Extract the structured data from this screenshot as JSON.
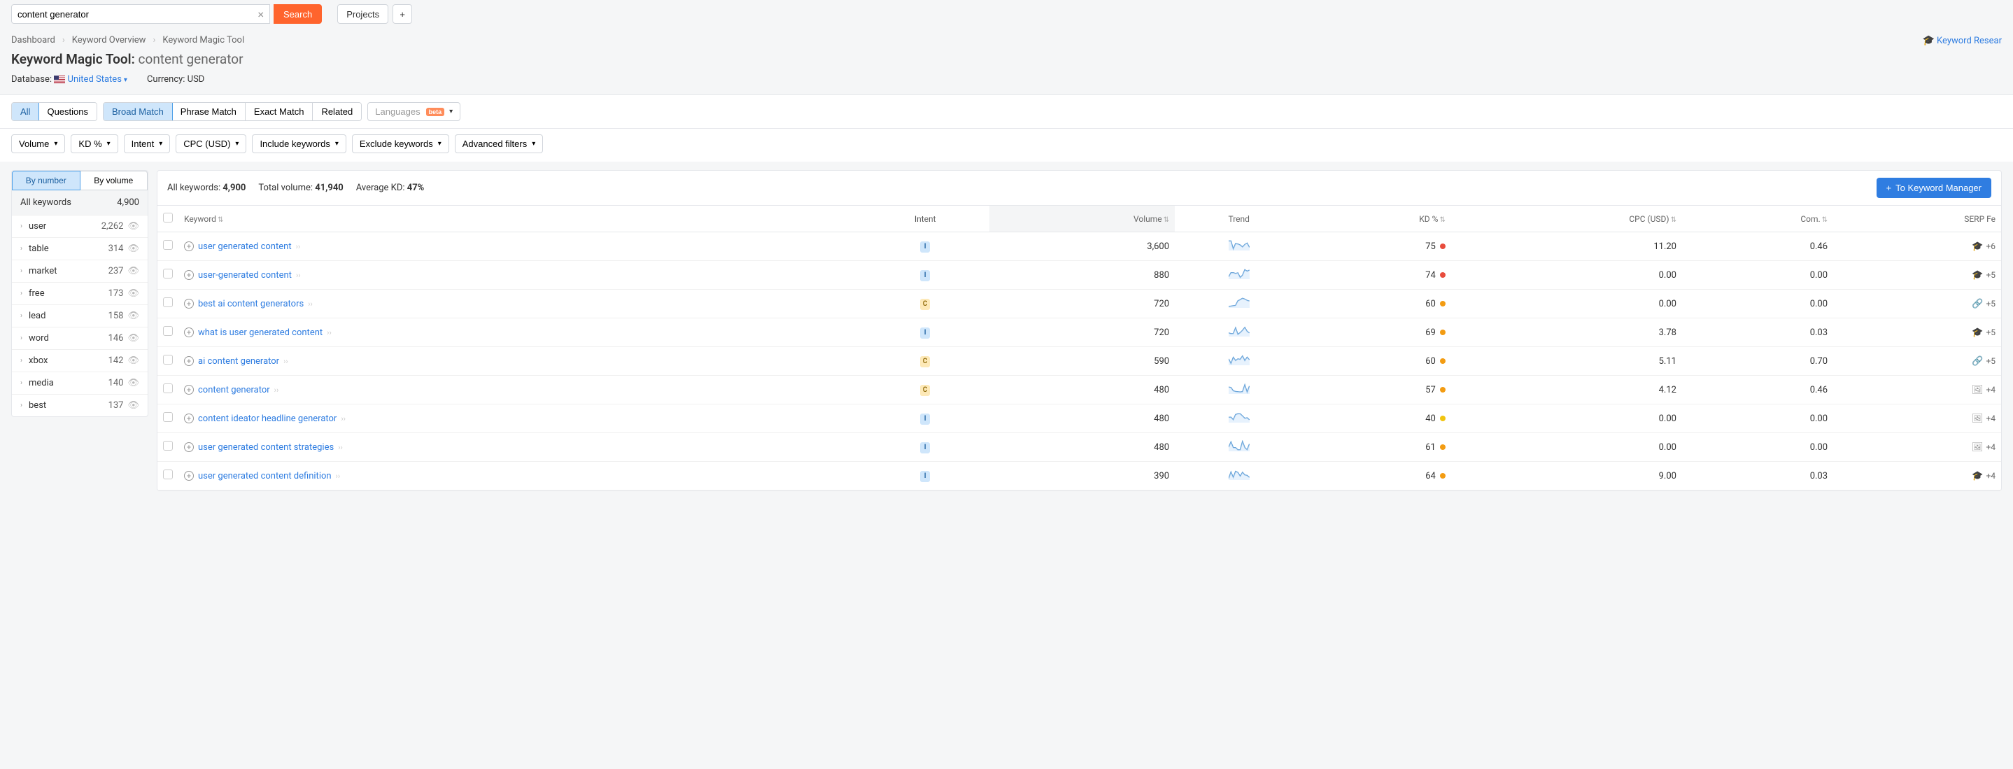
{
  "search": {
    "value": "content generator",
    "button": "Search",
    "projects": "Projects"
  },
  "breadcrumb": [
    "Dashboard",
    "Keyword Overview",
    "Keyword Magic Tool"
  ],
  "title": {
    "tool": "Keyword Magic Tool:",
    "query": "content generator"
  },
  "meta": {
    "db_label": "Database:",
    "db_value": "United States",
    "currency_label": "Currency: USD"
  },
  "research_link": "Keyword Resear",
  "match_tabs": {
    "all": "All",
    "questions": "Questions",
    "broad": "Broad Match",
    "phrase": "Phrase Match",
    "exact": "Exact Match",
    "related": "Related"
  },
  "lang_filter": {
    "label": "Languages",
    "badge": "beta"
  },
  "filters": {
    "volume": "Volume",
    "kd": "KD %",
    "intent": "Intent",
    "cpc": "CPC (USD)",
    "include": "Include keywords",
    "exclude": "Exclude keywords",
    "advanced": "Advanced filters"
  },
  "side_toggle": {
    "number": "By number",
    "volume": "By volume"
  },
  "side_all": {
    "label": "All keywords",
    "count": "4,900"
  },
  "side_items": [
    {
      "label": "user",
      "count": "2,262"
    },
    {
      "label": "table",
      "count": "314"
    },
    {
      "label": "market",
      "count": "237"
    },
    {
      "label": "free",
      "count": "173"
    },
    {
      "label": "lead",
      "count": "158"
    },
    {
      "label": "word",
      "count": "146"
    },
    {
      "label": "xbox",
      "count": "142"
    },
    {
      "label": "media",
      "count": "140"
    },
    {
      "label": "best",
      "count": "137"
    }
  ],
  "stats": {
    "all_label": "All keywords:",
    "all_value": "4,900",
    "vol_label": "Total volume:",
    "vol_value": "41,940",
    "kd_label": "Average KD:",
    "kd_value": "47%"
  },
  "to_manager": "To Keyword Manager",
  "columns": {
    "keyword": "Keyword",
    "intent": "Intent",
    "volume": "Volume",
    "trend": "Trend",
    "kd": "KD %",
    "cpc": "CPC (USD)",
    "com": "Com.",
    "serp": "SERP Fe"
  },
  "rows": [
    {
      "keyword": "user generated content",
      "intent": "I",
      "volume": "3,600",
      "kd": "75",
      "kd_color": "red",
      "cpc": "11.20",
      "com": "0.46",
      "serp": "+6",
      "serp_icon": "cap"
    },
    {
      "keyword": "user-generated content",
      "intent": "I",
      "volume": "880",
      "kd": "74",
      "kd_color": "red",
      "cpc": "0.00",
      "com": "0.00",
      "serp": "+5",
      "serp_icon": "cap"
    },
    {
      "keyword": "best ai content generators",
      "intent": "C",
      "volume": "720",
      "kd": "60",
      "kd_color": "orange",
      "cpc": "0.00",
      "com": "0.00",
      "serp": "+5",
      "serp_icon": "link"
    },
    {
      "keyword": "what is user generated content",
      "intent": "I",
      "volume": "720",
      "kd": "69",
      "kd_color": "orange",
      "cpc": "3.78",
      "com": "0.03",
      "serp": "+5",
      "serp_icon": "cap"
    },
    {
      "keyword": "ai content generator",
      "intent": "C",
      "volume": "590",
      "kd": "60",
      "kd_color": "orange",
      "cpc": "5.11",
      "com": "0.70",
      "serp": "+5",
      "serp_icon": "link"
    },
    {
      "keyword": "content generator",
      "intent": "C",
      "volume": "480",
      "kd": "57",
      "kd_color": "orange",
      "cpc": "4.12",
      "com": "0.46",
      "serp": "+4",
      "serp_icon": "img"
    },
    {
      "keyword": "content ideator headline generator",
      "intent": "I",
      "volume": "480",
      "kd": "40",
      "kd_color": "yellow",
      "cpc": "0.00",
      "com": "0.00",
      "serp": "+4",
      "serp_icon": "img"
    },
    {
      "keyword": "user generated content strategies",
      "intent": "I",
      "volume": "480",
      "kd": "61",
      "kd_color": "orange",
      "cpc": "0.00",
      "com": "0.00",
      "serp": "+4",
      "serp_icon": "img"
    },
    {
      "keyword": "user generated content definition",
      "intent": "I",
      "volume": "390",
      "kd": "64",
      "kd_color": "orange",
      "cpc": "9.00",
      "com": "0.03",
      "serp": "+4",
      "serp_icon": "cap"
    }
  ]
}
